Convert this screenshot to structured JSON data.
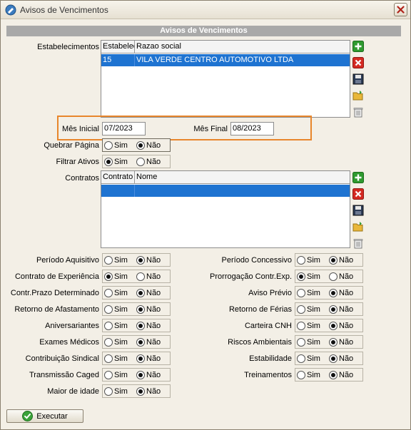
{
  "window": {
    "title": "Avisos de Vencimentos"
  },
  "header": {
    "title": "Avisos de Vencimentos"
  },
  "estabelecimentos": {
    "label": "Estabelecimentos",
    "columns": [
      "Estabelecimento",
      "Razao social"
    ],
    "rows": [
      {
        "code": "15",
        "name": "VILA VERDE CENTRO AUTOMOTIVO LTDA"
      }
    ]
  },
  "periodo": {
    "mes_inicial_label": "Mês Inicial",
    "mes_inicial_value": "07/2023",
    "mes_final_label": "Mês Final",
    "mes_final_value": "08/2023"
  },
  "options": {
    "sim": "Sim",
    "nao": "Não"
  },
  "quebrar_pagina": {
    "label": "Quebrar Página",
    "selected": "Não"
  },
  "filtrar_ativos": {
    "label": "Filtrar Ativos",
    "selected": "Sim"
  },
  "contratos": {
    "label": "Contratos",
    "columns": [
      "Contrato",
      "Nome"
    ],
    "rows": [
      {
        "code": "",
        "name": ""
      }
    ]
  },
  "left_filters": [
    {
      "label": "Período Aquisitivo",
      "selected": "Não"
    },
    {
      "label": "Contrato de Experiência",
      "selected": "Sim"
    },
    {
      "label": "Contr.Prazo Determinado",
      "selected": "Não"
    },
    {
      "label": "Retorno de Afastamento",
      "selected": "Não"
    },
    {
      "label": "Aniversariantes",
      "selected": "Não"
    },
    {
      "label": "Exames Médicos",
      "selected": "Não"
    },
    {
      "label": "Contribuição Sindical",
      "selected": "Não"
    },
    {
      "label": "Transmissão Caged",
      "selected": "Não"
    },
    {
      "label": "Maior de idade",
      "selected": "Não"
    }
  ],
  "right_filters": [
    {
      "label": "Período Concessivo",
      "selected": "Não"
    },
    {
      "label": "Prorrogação Contr.Exp.",
      "selected": "Sim"
    },
    {
      "label": "Aviso Prévio",
      "selected": "Não"
    },
    {
      "label": "Retorno de Férias",
      "selected": "Não"
    },
    {
      "label": "Carteira CNH",
      "selected": "Não"
    },
    {
      "label": "Riscos Ambientais",
      "selected": "Não"
    },
    {
      "label": "Estabilidade",
      "selected": "Não"
    },
    {
      "label": "Treinamentos",
      "selected": "Não"
    }
  ],
  "icons": {
    "add": "add-icon",
    "remove": "remove-icon",
    "save": "save-icon",
    "open": "open-folder-icon",
    "delete": "trash-icon",
    "execute": "check-icon"
  },
  "colors": {
    "accent": "#1e73d1",
    "highlight": "#e8862c",
    "header_bar": "#a9a9a9"
  },
  "footer": {
    "execute_label": "Executar"
  }
}
